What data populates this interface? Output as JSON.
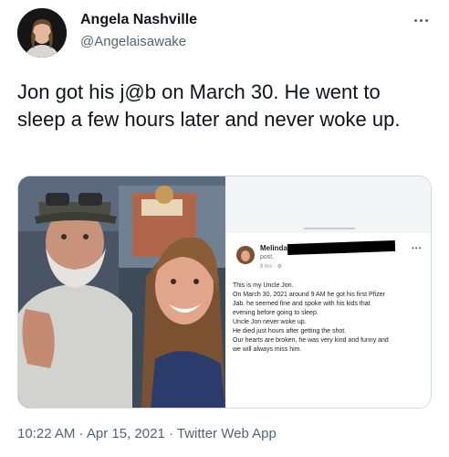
{
  "author": {
    "display_name": "Angela Nashville",
    "handle": "@Angelaisawake",
    "avatar_icon": "user-avatar-photo"
  },
  "more_icon": "more-horizontal-icon",
  "tweet": {
    "text": "Jon got his j@b on March 30. He went to sleep a few hours later and never woke up."
  },
  "media": {
    "post": {
      "author": "Melinda",
      "sub": "post.",
      "meta": "8 hrs · ⚙",
      "more": "•••",
      "lines": [
        "This is my Uncle Jon.",
        "On March 30, 2021 around 9 AM he got his first Pfizer",
        "Jab. he seemed fine and spoke with his kids that",
        "evening before going to sleep.",
        "Uncle Jon never woke up.",
        "He died just hours after getting the shot.",
        "Our hearts are broken, he was very kind and funny and",
        "we will always miss him."
      ]
    }
  },
  "footer": {
    "time": "10:22 AM",
    "sep1": " · ",
    "date": "Apr 15, 2021",
    "sep2": " · ",
    "source": "Twitter Web App"
  }
}
